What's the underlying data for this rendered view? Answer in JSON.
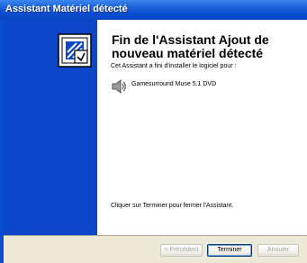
{
  "window": {
    "title": "Assistant Matériel détecté"
  },
  "wizard": {
    "heading": "Fin de l'Assistant Ajout de nouveau matériel détecté",
    "intro": "Cet Assistant a fini d'installer le logiciel pour :",
    "device_name": "Gamesurround Muse 5.1 DVD",
    "finish_message": "Cliquer sur Terminer pour fermer l'Assistant."
  },
  "buttons": {
    "back": "< Précédent",
    "finish": "Terminer",
    "cancel": "Annuler"
  },
  "colors": {
    "title_bar": "#0a4ccf",
    "banner": "#0d47c9",
    "footer": "#ece9d8"
  },
  "icons": {
    "wizard": "hardware-wizard-icon",
    "device": "speaker-icon"
  }
}
